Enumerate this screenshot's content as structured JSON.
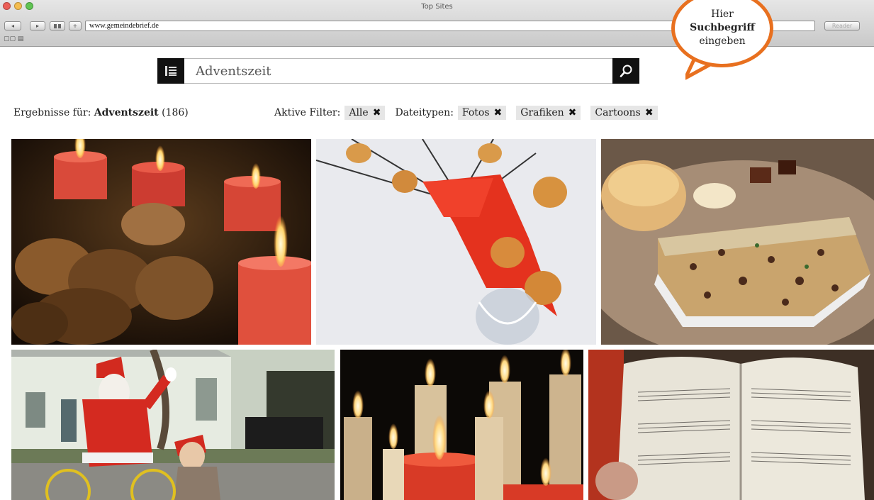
{
  "browser": {
    "window_title": "Top Sites",
    "url": "www.gemeindebrief.de",
    "nav_back": "◂",
    "nav_forward": "▸",
    "reload_label": "Reader",
    "bookmarks": "▢▢ ▤"
  },
  "search": {
    "value": "Adventszeit"
  },
  "callout": {
    "line1": "Hier",
    "line2": "Suchbegriff",
    "line3": "eingeben"
  },
  "results": {
    "prefix": "Ergebnisse für: ",
    "term": "Adventszeit",
    "count": " (186)"
  },
  "filters": {
    "active_label": "Aktive Filter:",
    "active": [
      {
        "label": "Alle"
      }
    ],
    "types_label": "Dateitypen:",
    "types": [
      {
        "label": "Fotos"
      },
      {
        "label": "Grafiken"
      },
      {
        "label": "Cartoons"
      }
    ]
  },
  "photos": [
    {
      "subject": "candles-and-walnuts"
    },
    {
      "subject": "cookie-hearts-with-red-ribbon"
    },
    {
      "subject": "stollen-and-bread"
    },
    {
      "subject": "santa-on-bicycle"
    },
    {
      "subject": "candles-in-dark"
    },
    {
      "subject": "hymn-book"
    }
  ],
  "colors": {
    "accent": "#e8701f",
    "search_button": "#111111",
    "chip_bg": "#e6e6e6"
  }
}
